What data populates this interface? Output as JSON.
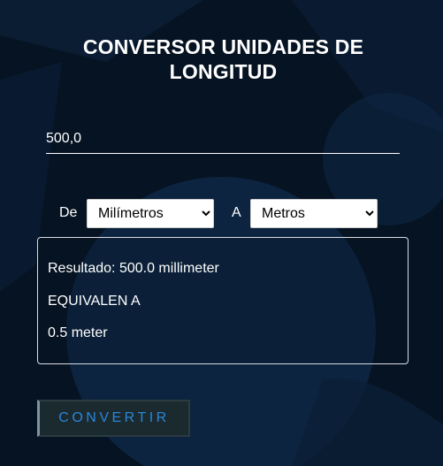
{
  "header": {
    "title": "CONVERSOR UNIDADES DE LONGITUD"
  },
  "form": {
    "value": "500,0",
    "from_label": "De",
    "from_selected": "Milímetros",
    "to_label": "A",
    "to_selected": "Metros"
  },
  "result": {
    "line1": "Resultado: 500.0 millimeter",
    "line2": "EQUIVALEN A",
    "line3": "0.5 meter"
  },
  "actions": {
    "convert_label": "CONVERTIR"
  },
  "icons": {
    "dropdown": "chevron-down-icon"
  },
  "colors": {
    "background": "#061322",
    "button_text": "#2a86d9",
    "text": "#ffffff"
  }
}
